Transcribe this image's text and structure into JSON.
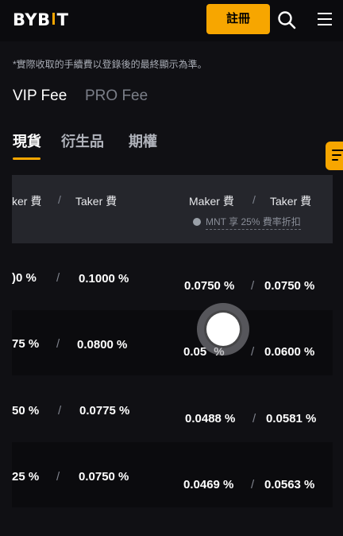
{
  "header": {
    "logo_text_1": "BYB",
    "logo_text_2": "T",
    "register_label": "註冊"
  },
  "note": "*實際收取的手續費以登錄後的最終顯示為準。",
  "fee_tabs": [
    "VIP Fee",
    "PRO Fee"
  ],
  "market_tabs": [
    "現貨",
    "衍生品",
    "期權"
  ],
  "table_header": {
    "left_maker": "ker 費",
    "left_sep": "/",
    "left_taker": "Taker 費",
    "right_maker": "Maker 費",
    "right_sep": "/",
    "right_taker": "Taker 費",
    "mnt_note": "MNT 享 25% 費率折扣"
  },
  "rows": [
    {
      "left_maker": ")0 %",
      "left_taker": "0.1000 %",
      "right_maker": "0.0750 %",
      "right_taker": "0.0750 %"
    },
    {
      "left_maker": "75 %",
      "left_taker": "0.0800 %",
      "right_maker": "0.05   %",
      "right_taker": "0.0600 %"
    },
    {
      "left_maker": "50 %",
      "left_taker": "0.0775 %",
      "right_maker": "0.0488 %",
      "right_taker": "0.0581 %"
    },
    {
      "left_maker": "25 %",
      "left_taker": "0.0750 %",
      "right_maker": "0.0469 %",
      "right_taker": "0.0563 %"
    }
  ],
  "separator": "/",
  "colors": {
    "accent": "#f7a600",
    "background": "#101014",
    "row_band": "#0b0b0e",
    "header_band": "#25262c"
  }
}
